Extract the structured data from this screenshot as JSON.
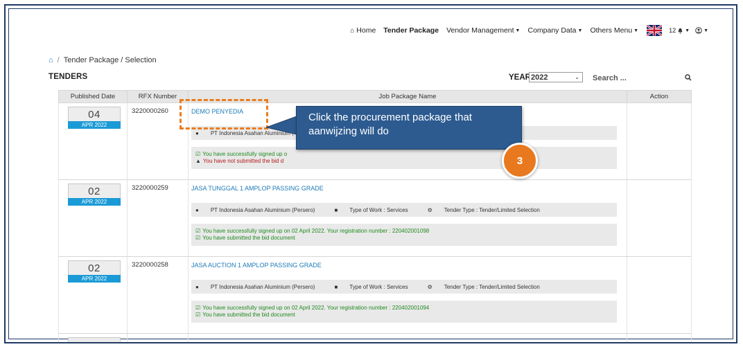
{
  "nav": {
    "home": "Home",
    "tender_package": "Tender Package",
    "vendor_management": "Vendor Management",
    "company_data": "Company Data",
    "others_menu": "Others Menu",
    "notification_count": "12"
  },
  "breadcrumb": {
    "path": "Tender Package / Selection"
  },
  "page_title": "TENDERS",
  "filters": {
    "year_label": "YEAR",
    "year_value": "2022",
    "search_placeholder": "Search ..."
  },
  "table": {
    "headers": {
      "published_date": "Published Date",
      "rfx_number": "RFX Number",
      "job_package_name": "Job Package Name",
      "action": "Action"
    },
    "rows": [
      {
        "day": "04",
        "month": "APR 2022",
        "rfx": "3220000260",
        "name": "DEMO PENYEDIA",
        "company": "PT Indonesia Asahan Aluminium (",
        "type_tail": "n",
        "status1": "You have successfully signed up o",
        "status2": "You have not submitted the bid d"
      },
      {
        "day": "02",
        "month": "APR 2022",
        "rfx": "3220000259",
        "name": "JASA TUNGGAL 1 AMPLOP PASSING GRADE",
        "company": "PT Indonesia Asahan Aluminium (Persero)",
        "work_type": "Type of Work : Services",
        "tender_type": "Tender Type : Tender/Limited Selection",
        "status1": "You have successfully signed up on 02 April 2022. Your registration number : 220402001098",
        "status2": "You have submitted the bid document"
      },
      {
        "day": "02",
        "month": "APR 2022",
        "rfx": "3220000258",
        "name": "JASA AUCTION 1 AMPLOP PASSING GRADE",
        "company": "PT Indonesia Asahan Aluminium (Persero)",
        "work_type": "Type of Work : Services",
        "tender_type": "Tender Type : Tender/Limited Selection",
        "status1": "You have successfully signed up on 02 April 2022. Your registration number : 220402001094",
        "status2": "You have submitted the bid document"
      }
    ]
  },
  "annotation": {
    "callout_text": "Click the procurement package that aanwijzing will do",
    "step_number": "3"
  },
  "colors": {
    "link": "#1d7ab8",
    "date_month_bg": "#1a9ad6",
    "callout_bg": "#2d5b90",
    "annotation_orange": "#e87d20",
    "success_green": "#1f8a1f",
    "warning_red": "#b31b1b"
  }
}
